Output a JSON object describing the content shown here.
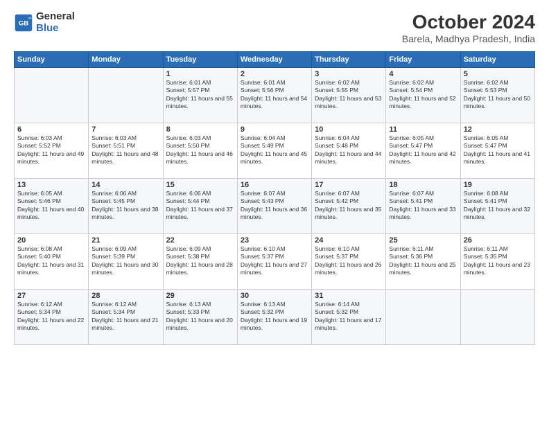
{
  "header": {
    "logo_line1": "General",
    "logo_line2": "Blue",
    "title": "October 2024",
    "subtitle": "Barela, Madhya Pradesh, India"
  },
  "columns": [
    "Sunday",
    "Monday",
    "Tuesday",
    "Wednesday",
    "Thursday",
    "Friday",
    "Saturday"
  ],
  "weeks": [
    [
      {
        "day": "",
        "text": ""
      },
      {
        "day": "",
        "text": ""
      },
      {
        "day": "1",
        "text": "Sunrise: 6:01 AM\nSunset: 5:57 PM\nDaylight: 11 hours and 55 minutes."
      },
      {
        "day": "2",
        "text": "Sunrise: 6:01 AM\nSunset: 5:56 PM\nDaylight: 11 hours and 54 minutes."
      },
      {
        "day": "3",
        "text": "Sunrise: 6:02 AM\nSunset: 5:55 PM\nDaylight: 11 hours and 53 minutes."
      },
      {
        "day": "4",
        "text": "Sunrise: 6:02 AM\nSunset: 5:54 PM\nDaylight: 11 hours and 52 minutes."
      },
      {
        "day": "5",
        "text": "Sunrise: 6:02 AM\nSunset: 5:53 PM\nDaylight: 11 hours and 50 minutes."
      }
    ],
    [
      {
        "day": "6",
        "text": "Sunrise: 6:03 AM\nSunset: 5:52 PM\nDaylight: 11 hours and 49 minutes."
      },
      {
        "day": "7",
        "text": "Sunrise: 6:03 AM\nSunset: 5:51 PM\nDaylight: 11 hours and 48 minutes."
      },
      {
        "day": "8",
        "text": "Sunrise: 6:03 AM\nSunset: 5:50 PM\nDaylight: 11 hours and 46 minutes."
      },
      {
        "day": "9",
        "text": "Sunrise: 6:04 AM\nSunset: 5:49 PM\nDaylight: 11 hours and 45 minutes."
      },
      {
        "day": "10",
        "text": "Sunrise: 6:04 AM\nSunset: 5:48 PM\nDaylight: 11 hours and 44 minutes."
      },
      {
        "day": "11",
        "text": "Sunrise: 6:05 AM\nSunset: 5:47 PM\nDaylight: 11 hours and 42 minutes."
      },
      {
        "day": "12",
        "text": "Sunrise: 6:05 AM\nSunset: 5:47 PM\nDaylight: 11 hours and 41 minutes."
      }
    ],
    [
      {
        "day": "13",
        "text": "Sunrise: 6:05 AM\nSunset: 5:46 PM\nDaylight: 11 hours and 40 minutes."
      },
      {
        "day": "14",
        "text": "Sunrise: 6:06 AM\nSunset: 5:45 PM\nDaylight: 11 hours and 38 minutes."
      },
      {
        "day": "15",
        "text": "Sunrise: 6:06 AM\nSunset: 5:44 PM\nDaylight: 11 hours and 37 minutes."
      },
      {
        "day": "16",
        "text": "Sunrise: 6:07 AM\nSunset: 5:43 PM\nDaylight: 11 hours and 36 minutes."
      },
      {
        "day": "17",
        "text": "Sunrise: 6:07 AM\nSunset: 5:42 PM\nDaylight: 11 hours and 35 minutes."
      },
      {
        "day": "18",
        "text": "Sunrise: 6:07 AM\nSunset: 5:41 PM\nDaylight: 11 hours and 33 minutes."
      },
      {
        "day": "19",
        "text": "Sunrise: 6:08 AM\nSunset: 5:41 PM\nDaylight: 11 hours and 32 minutes."
      }
    ],
    [
      {
        "day": "20",
        "text": "Sunrise: 6:08 AM\nSunset: 5:40 PM\nDaylight: 11 hours and 31 minutes."
      },
      {
        "day": "21",
        "text": "Sunrise: 6:09 AM\nSunset: 5:39 PM\nDaylight: 11 hours and 30 minutes."
      },
      {
        "day": "22",
        "text": "Sunrise: 6:09 AM\nSunset: 5:38 PM\nDaylight: 11 hours and 28 minutes."
      },
      {
        "day": "23",
        "text": "Sunrise: 6:10 AM\nSunset: 5:37 PM\nDaylight: 11 hours and 27 minutes."
      },
      {
        "day": "24",
        "text": "Sunrise: 6:10 AM\nSunset: 5:37 PM\nDaylight: 11 hours and 26 minutes."
      },
      {
        "day": "25",
        "text": "Sunrise: 6:11 AM\nSunset: 5:36 PM\nDaylight: 11 hours and 25 minutes."
      },
      {
        "day": "26",
        "text": "Sunrise: 6:11 AM\nSunset: 5:35 PM\nDaylight: 11 hours and 23 minutes."
      }
    ],
    [
      {
        "day": "27",
        "text": "Sunrise: 6:12 AM\nSunset: 5:34 PM\nDaylight: 11 hours and 22 minutes."
      },
      {
        "day": "28",
        "text": "Sunrise: 6:12 AM\nSunset: 5:34 PM\nDaylight: 11 hours and 21 minutes."
      },
      {
        "day": "29",
        "text": "Sunrise: 6:13 AM\nSunset: 5:33 PM\nDaylight: 11 hours and 20 minutes."
      },
      {
        "day": "30",
        "text": "Sunrise: 6:13 AM\nSunset: 5:32 PM\nDaylight: 11 hours and 19 minutes."
      },
      {
        "day": "31",
        "text": "Sunrise: 6:14 AM\nSunset: 5:32 PM\nDaylight: 11 hours and 17 minutes."
      },
      {
        "day": "",
        "text": ""
      },
      {
        "day": "",
        "text": ""
      }
    ]
  ]
}
